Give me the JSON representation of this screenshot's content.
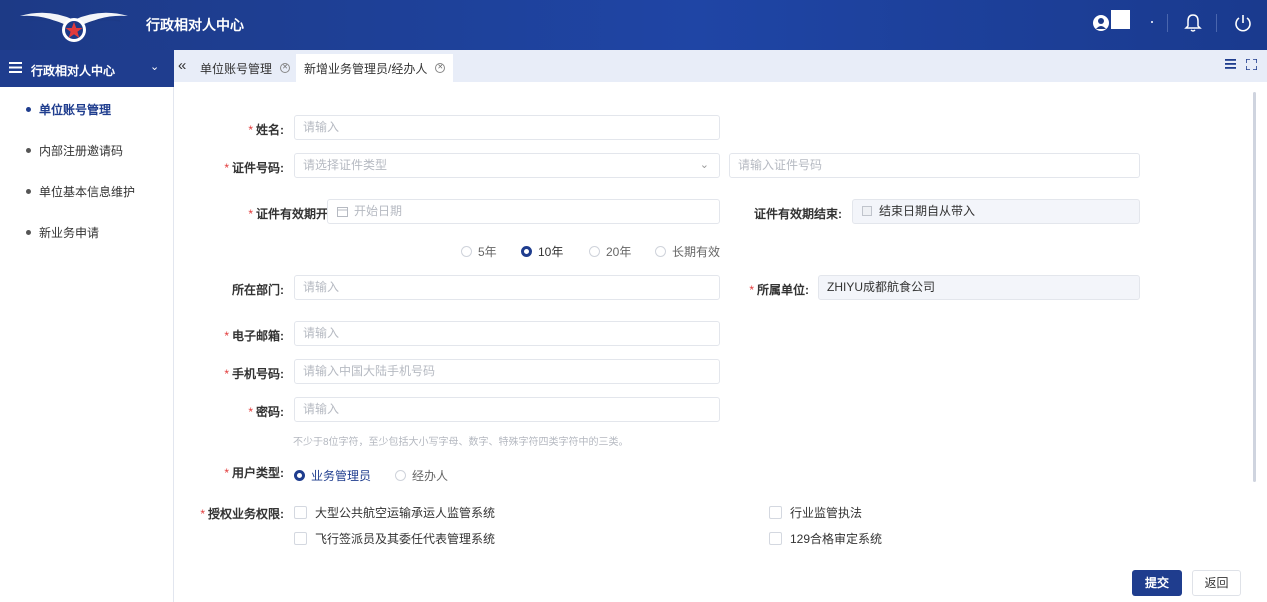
{
  "header": {
    "app_title": "行政相对人中心"
  },
  "sidebar": {
    "title": "行政相对人中心",
    "items": [
      {
        "label": "单位账号管理",
        "active": true
      },
      {
        "label": "内部注册邀请码",
        "active": false
      },
      {
        "label": "单位基本信息维护",
        "active": false
      },
      {
        "label": "新业务申请",
        "active": false
      }
    ]
  },
  "tabs": [
    {
      "label": "单位账号管理",
      "active": false
    },
    {
      "label": "新增业务管理员/经办人",
      "active": true
    }
  ],
  "form": {
    "name": {
      "label": "姓名:",
      "placeholder": "请输入"
    },
    "id_number": {
      "label": "证件号码:",
      "type_placeholder": "请选择证件类型",
      "number_placeholder": "请输入证件号码"
    },
    "validity_start": {
      "label": "证件有效期开始:",
      "placeholder": "开始日期"
    },
    "validity_end": {
      "label": "证件有效期结束:",
      "value": "结束日期自从带入"
    },
    "validity_options": [
      {
        "label": "5年",
        "selected": false
      },
      {
        "label": "10年",
        "selected": true
      },
      {
        "label": "20年",
        "selected": false
      },
      {
        "label": "长期有效",
        "selected": false
      }
    ],
    "department": {
      "label": "所在部门:",
      "placeholder": "请输入"
    },
    "unit": {
      "label": "所属单位:",
      "value": "ZHIYU成都航食公司"
    },
    "email": {
      "label": "电子邮箱:",
      "placeholder": "请输入"
    },
    "phone": {
      "label": "手机号码:",
      "placeholder": "请输入中国大陆手机号码"
    },
    "password": {
      "label": "密码:",
      "placeholder": "请输入",
      "hint": "不少于8位字符，至少包括大小写字母、数字、特殊字符四类字符中的三类。"
    },
    "user_type": {
      "label": "用户类型:",
      "options": [
        {
          "label": "业务管理员",
          "selected": true
        },
        {
          "label": "经办人",
          "selected": false
        }
      ]
    },
    "permissions": {
      "label": "授权业务权限:",
      "options": [
        "大型公共航空运输承运人监管系统",
        "行业监管执法",
        "飞行签派员及其委任代表管理系统",
        "129合格审定系统"
      ]
    }
  },
  "actions": {
    "submit": "提交",
    "back": "返回"
  }
}
